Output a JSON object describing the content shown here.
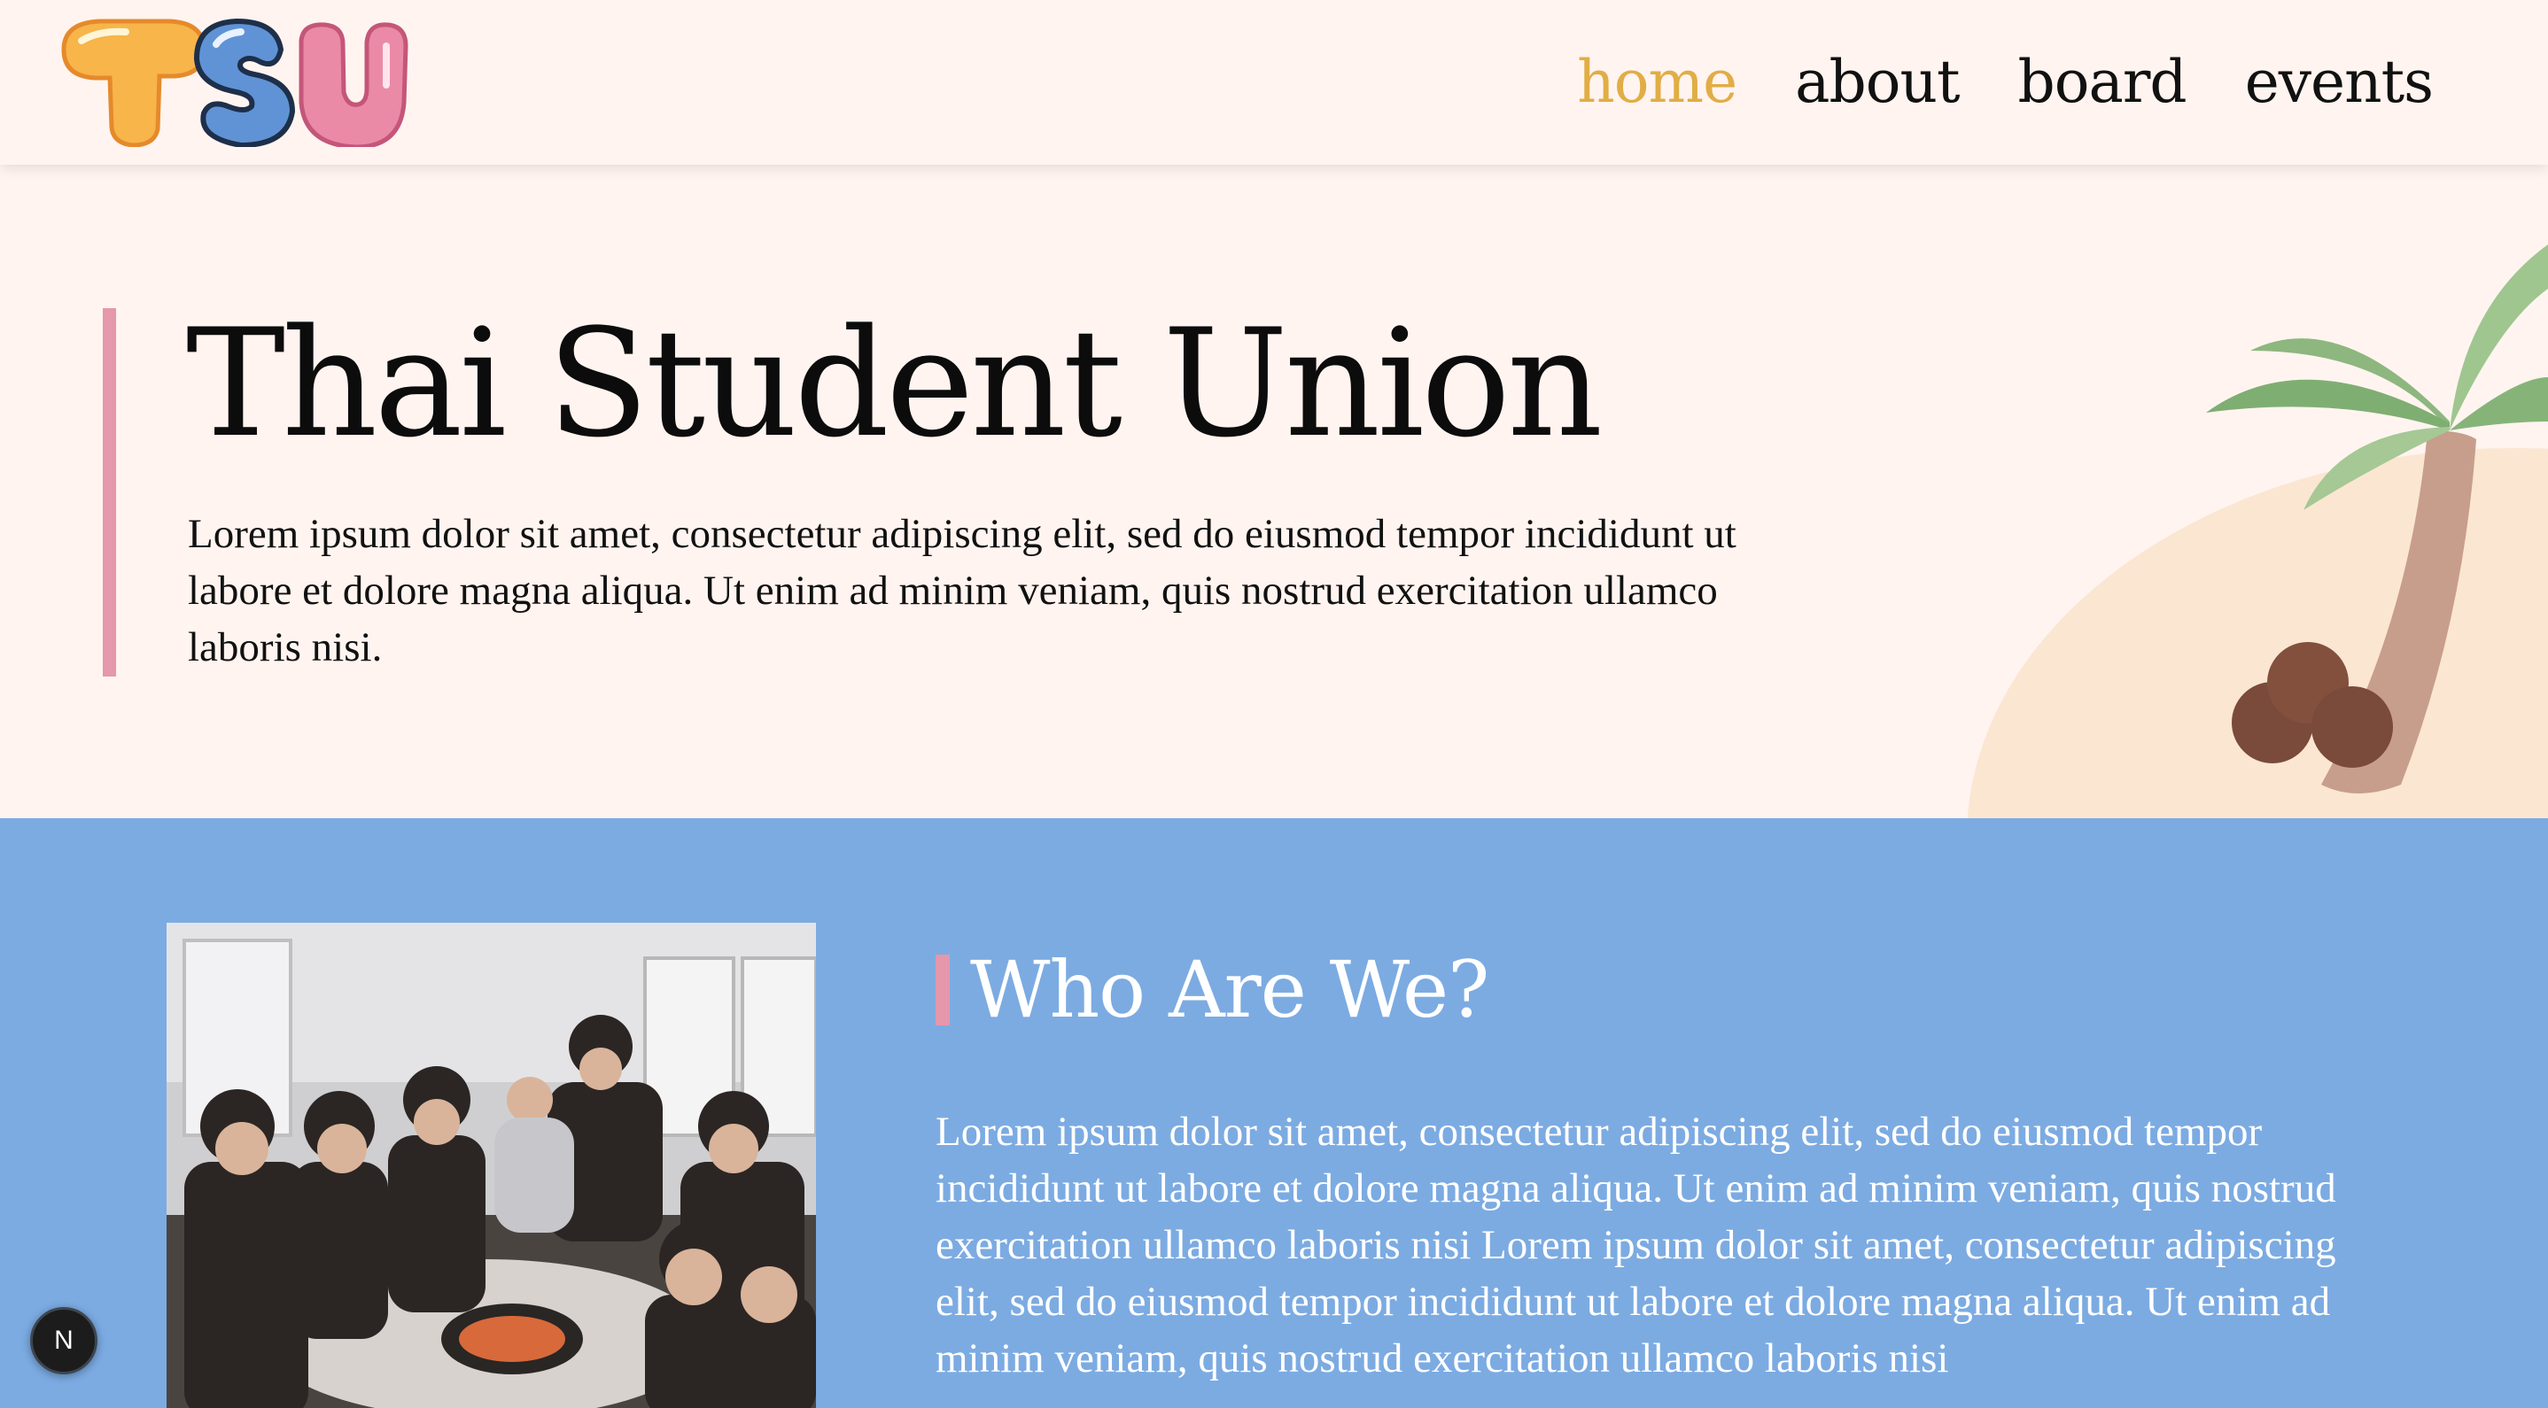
{
  "brand": {
    "logo_letters": "TSU"
  },
  "nav": {
    "items": [
      {
        "label": "home",
        "active": true
      },
      {
        "label": "about",
        "active": false
      },
      {
        "label": "board",
        "active": false
      },
      {
        "label": "events",
        "active": false
      }
    ]
  },
  "hero": {
    "title": "Thai Student Union",
    "text": "Lorem ipsum dolor sit amet, consectetur adipiscing elit, sed do eiusmod tempor incididunt ut labore et dolore magna aliqua. Ut enim ad minim veniam, quis nostrud exercitation ullamco laboris nisi."
  },
  "about": {
    "title": "Who Are We?",
    "text": "Lorem ipsum dolor sit amet, consectetur adipiscing elit, sed do eiusmod tempor incididunt ut labore et dolore magna aliqua. Ut enim ad minim veniam, quis nostrud exercitation ullamco laboris nisi Lorem ipsum dolor sit amet, consectetur adipiscing elit, sed do eiusmod tempor incididunt ut labore et dolore magna aliqua. Ut enim ad minim veniam, quis nostrud exercitation ullamco laboris nisi"
  },
  "dev_badge": {
    "letter": "N"
  },
  "colors": {
    "background": "#fff4f0",
    "accent_pink": "#e597ab",
    "accent_blue": "#7cabe2",
    "nav_active": "#e1ad45"
  }
}
